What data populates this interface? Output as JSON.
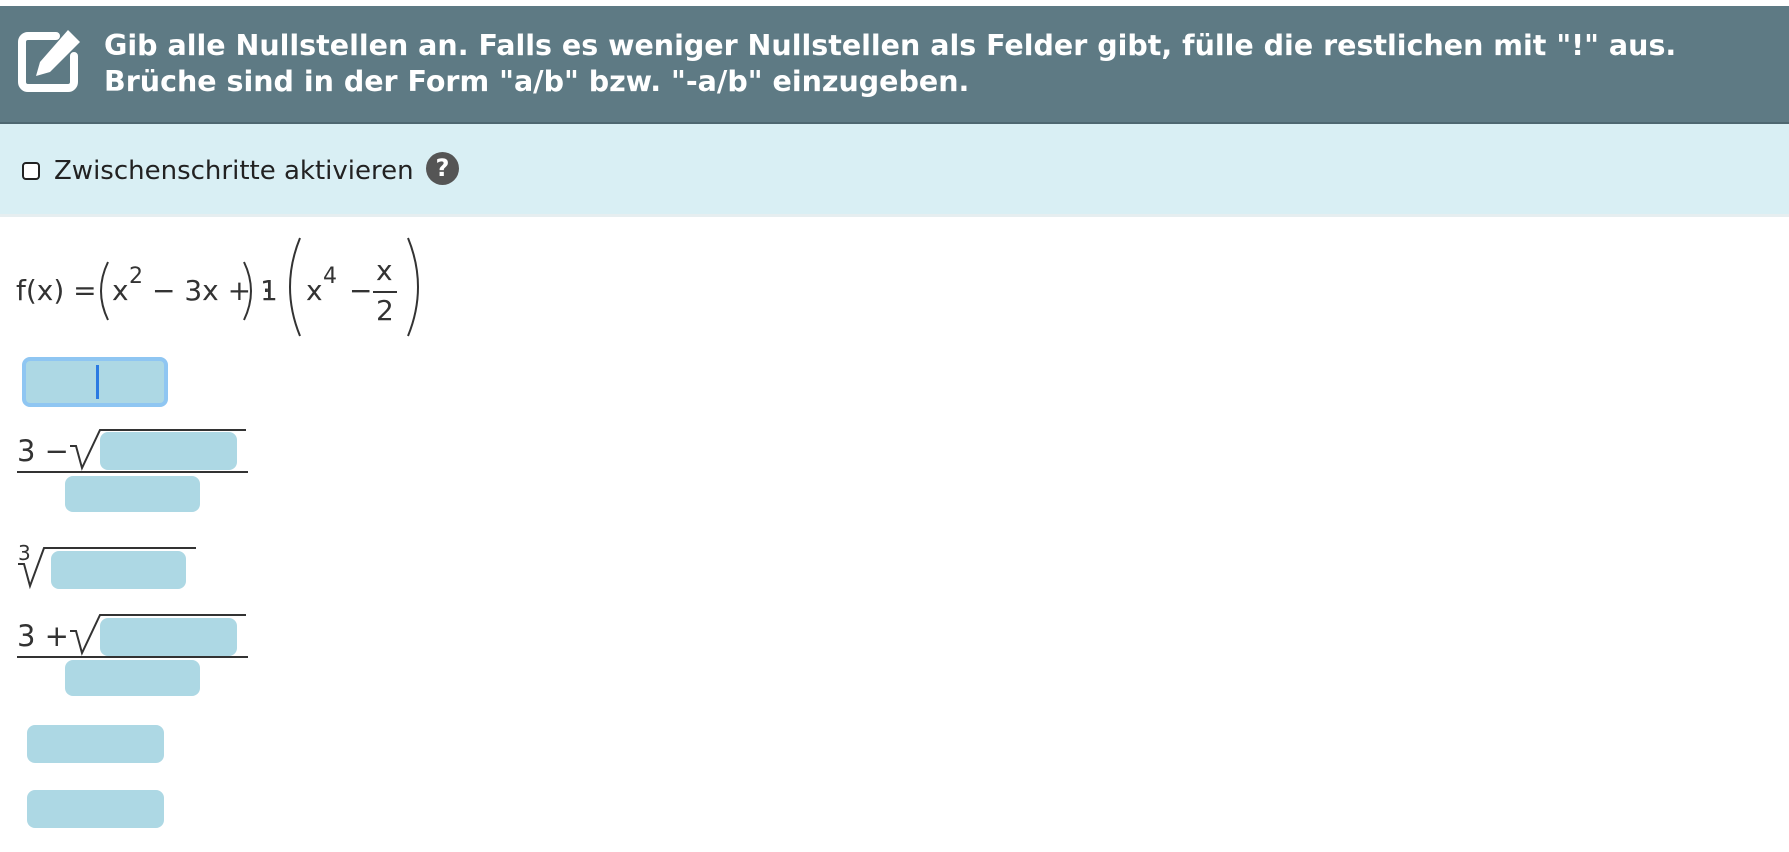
{
  "header": {
    "instruction": "Gib alle Nullstellen an. Falls es weniger Nullstellen als Felder gibt, fülle die restlichen mit \"!\" aus. Brüche sind in der Form \"a/b\" bzw. \"-a/b\" einzugeben.",
    "icon": "edit-icon"
  },
  "options": {
    "steps_label": "Zwischenschritte aktivieren",
    "steps_checked": false,
    "help_symbol": "?"
  },
  "function": {
    "lhs": "f(x) =",
    "first_factor": {
      "x": "x",
      "exp": "2",
      "rest": "− 3x + 1"
    },
    "dot": "·",
    "second_factor": {
      "x": "x",
      "exp": "4",
      "minus": "−",
      "num": "x",
      "den": "2"
    }
  },
  "answers": {
    "field1": {
      "value": ""
    },
    "field2": {
      "prefix": "3 −",
      "root_value": "",
      "den_value": ""
    },
    "field3": {
      "root_index": "3",
      "root_value": ""
    },
    "field4": {
      "prefix": "3 +",
      "root_value": "",
      "den_value": ""
    },
    "field5": {
      "value": ""
    },
    "field6": {
      "value": ""
    }
  }
}
